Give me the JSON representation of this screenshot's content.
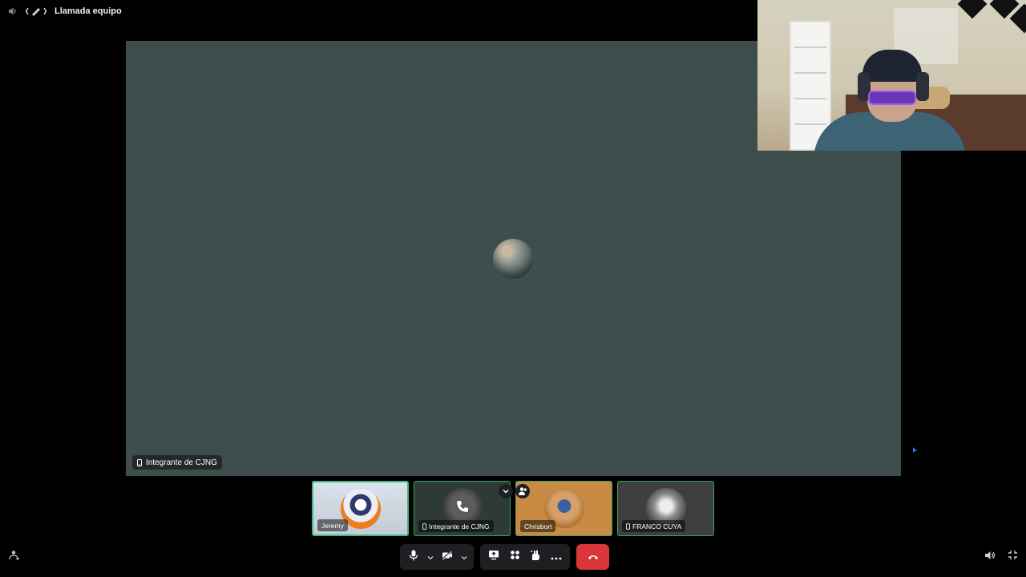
{
  "call": {
    "title": "Llamada equipo",
    "speaker_icon": "speaker-icon",
    "channel_icon": "stage-channel-icon"
  },
  "stage": {
    "participant_label": "Integrante de CJNG",
    "label_icon": "mobile-phone-icon"
  },
  "tiles": [
    {
      "name": "Jeremy",
      "mobile": false
    },
    {
      "name": "Integrante de CJNG",
      "mobile": true
    },
    {
      "name": "Chrisbort",
      "mobile": false
    },
    {
      "name": "FRANCO CUYA",
      "mobile": true
    }
  ],
  "tile_overlay_icons": [
    "chevron-down-icon",
    "add-person-icon"
  ],
  "controls": {
    "buttons": [
      "microphone-icon",
      "chevron-down-icon",
      "camera-off-icon",
      "chevron-down-icon",
      "screen-share-icon",
      "activities-icon",
      "soundboard-icon",
      "more-icon",
      "hang-up-icon"
    ]
  },
  "corners": {
    "left": "voice-activity-icon",
    "right_volume": "volume-icon",
    "right_fullscreen": "exit-fullscreen-icon"
  },
  "colors": {
    "stage_bg": "#3e4e4c",
    "speaking_border": "#3ba55d",
    "hang_up": "#da373c",
    "control_bg": "#1e1f22"
  }
}
